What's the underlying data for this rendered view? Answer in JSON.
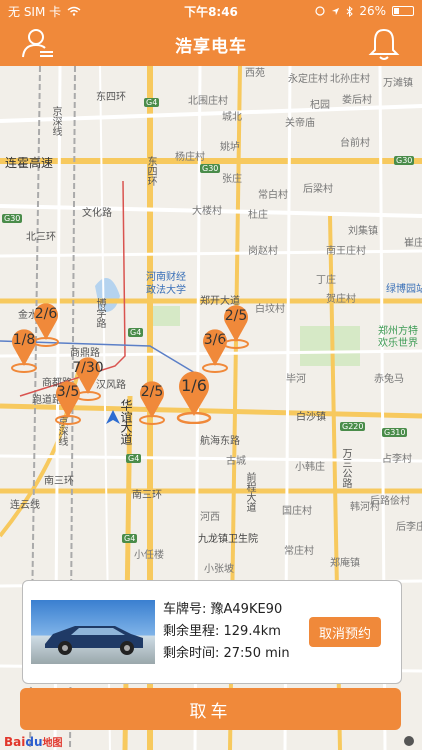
{
  "status": {
    "carrier": "无 SIM 卡",
    "time": "下午8:46",
    "battery": "26%"
  },
  "nav": {
    "title": "浩享电车",
    "left_icon": "user-menu-icon",
    "right_icon": "bell-icon"
  },
  "map": {
    "labels": {
      "xiyuan": "西苑",
      "yongding": "永定庄村",
      "beisun": "北孙庄村",
      "wantan": "万滩镇",
      "dongsihuan": "东四环",
      "beiwei": "北围庄村",
      "qiyuan": "杞园",
      "louhou": "娄后村",
      "chengbei": "城北",
      "guanmiao": "关帝庙",
      "beiyang": "北杨庄",
      "yangzhuang": "杨庄村",
      "taiqian": "台前村",
      "yaolu": "姚垆",
      "lianhuo": "连霍高速",
      "jingshenxian": "京深线",
      "changbai": "常白村",
      "houliang": "后梁村",
      "zhangzhuang": "张庄",
      "dongsihuan2": "东四环",
      "wenhua": "文化路",
      "beisanhuan": "北三环",
      "dakuan": "大楼村",
      "duzhuang": "杜庄",
      "liuji": "刘集镇",
      "cuicun": "崔庄",
      "gangzhao": "岗赵村",
      "nanwang": "南王庄村",
      "caijing": "河南财经",
      "zhengfa": "政法大学",
      "dingzhuang": "丁庄",
      "lvbo": "绿博园站",
      "zhengkai": "郑开大道",
      "baiyuan": "白坟村",
      "hesheng": "贺庄村",
      "fangte1": "郑州方特",
      "fangte2": "欢乐世界",
      "jinshui": "金水路",
      "bixue": "博学路",
      "shangcheng": "商鼎路",
      "hanfeng": "汉风路",
      "shangding": "商都路",
      "hongzhuan": "跑道路",
      "huayuan": "华谊",
      "daodao": "大道",
      "bimu": "毕河",
      "chitu": "赤兔马",
      "baishan": "白沙镇",
      "lianghu": "航海东路",
      "guchen": "古城",
      "xiaohan": "小韩庄",
      "wansan": "万三公路",
      "zhanli": "占李村",
      "qianchen": "前程大道",
      "jingguang": "京深线",
      "nansanhuan": "南三环",
      "nansanhuan2": "南三环",
      "houlu": "后路侩村",
      "guozhuang": "国庄村",
      "lianyun": "连云线",
      "hexi": "河西",
      "hanxin": "韩河村",
      "houzhuang": "后李庄",
      "jiulong": "九龙镇卫生院",
      "xiaorenz": "小任楼",
      "changzhuang": "常庄村",
      "zhengan": "郑庵镇",
      "xiaozhang": "小张坡"
    },
    "badges": {
      "g4_top": "G4",
      "g30_a": "G30",
      "g30_b": "G30",
      "g30_c": "G30",
      "g4_mid": "G4",
      "g220": "G220",
      "g310": "G310",
      "g4_low": "G4",
      "g4_bot": "G4"
    },
    "pins": [
      {
        "label": "2/6"
      },
      {
        "label": "1/8"
      },
      {
        "label": "7/30"
      },
      {
        "label": "3/5"
      },
      {
        "label": "2/5"
      },
      {
        "label": "1/6"
      },
      {
        "label": "3/6"
      },
      {
        "label": "2/5"
      }
    ]
  },
  "card": {
    "plate_label": "车牌号: 豫A49KE90",
    "range_label": "剩余里程: 129.4km",
    "time_label": "剩余时间: 27:50 min",
    "cancel_label": "取消预约"
  },
  "take_car_label": "取车",
  "baidu": {
    "logo_a": "Bai",
    "logo_b": "du",
    "logo_c": "地图"
  },
  "colors": {
    "accent": "#f0893a",
    "road_main": "#f7c95e",
    "road_sub": "#ffffff"
  }
}
